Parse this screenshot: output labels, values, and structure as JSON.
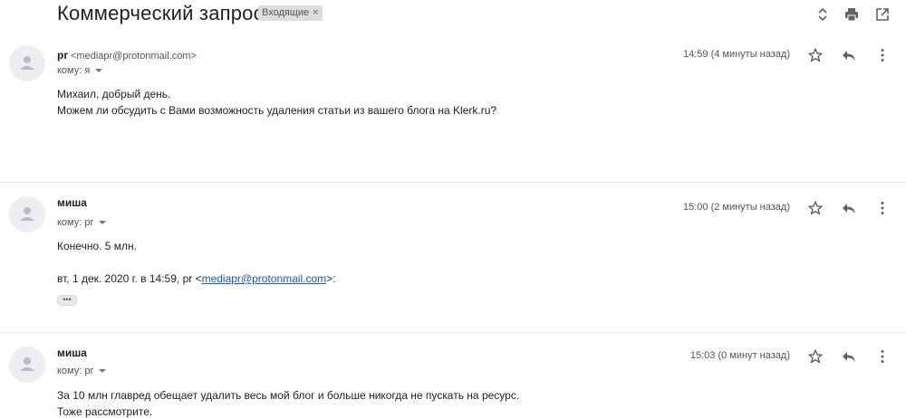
{
  "subject": "Коммерческий запрос",
  "label": {
    "text": "Входящие",
    "close": "×"
  },
  "toolbar_icons": [
    "expand-collapse-icon",
    "print-icon",
    "open-new-window-icon"
  ],
  "messages": [
    {
      "sender_name": "pr",
      "sender_email": "<mediapr@protonmail.com>",
      "recipient": "кому: я",
      "timestamp": "14:59 (4 минуты назад)",
      "body": [
        "Михаил, добрый день.",
        "Можем ли обсудить с Вами возможность удаления статьи из вашего блога на Klerk.ru?"
      ]
    },
    {
      "sender_name": "миша",
      "sender_email": "",
      "recipient": "кому: pr",
      "timestamp": "15:00 (2 минуты назад)",
      "body": [
        "Конечно. 5 млн."
      ],
      "quote_prefix": "вт, 1 дек. 2020 г. в 14:59, pr <",
      "quote_link": "mediapr@protonmail.com",
      "quote_suffix": ">:",
      "show_trimmed": "•••"
    },
    {
      "sender_name": "миша",
      "sender_email": "",
      "recipient": "кому: pr",
      "timestamp": "15:03 (0 минут назад)",
      "body": [
        "За 10 млн главред обещает удалить весь мой блог и больше никогда не пускать на ресурс.",
        "Тоже рассмотрите."
      ]
    }
  ],
  "message_icons": [
    "star-icon",
    "reply-icon",
    "more-vert-icon"
  ]
}
